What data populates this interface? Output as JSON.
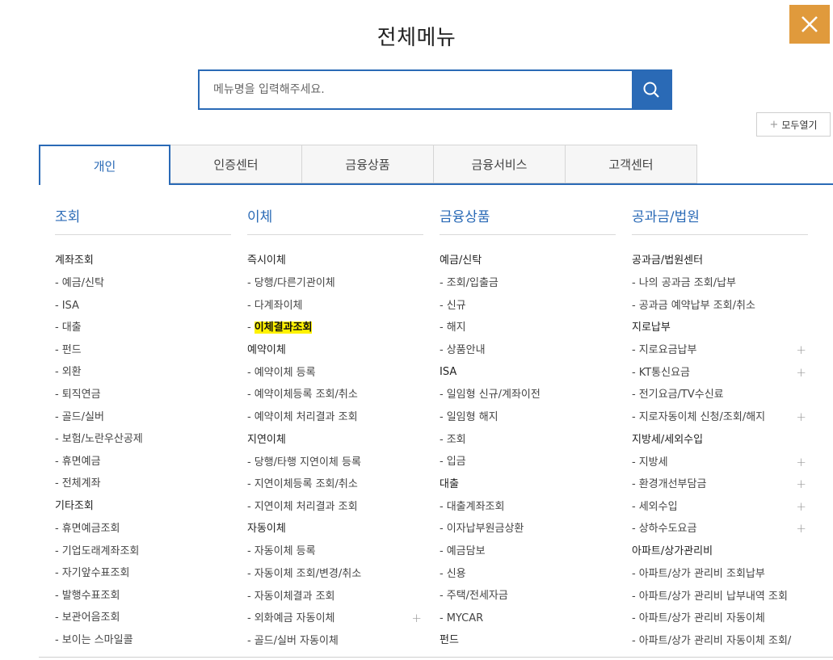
{
  "title": "전체메뉴",
  "close_icon": "close-icon",
  "search": {
    "placeholder": "메뉴명을 입력해주세요.",
    "value": ""
  },
  "open_all": {
    "plus": "+",
    "label": "모두열기"
  },
  "tabs": [
    {
      "label": "개인",
      "active": true
    },
    {
      "label": "인증센터"
    },
    {
      "label": "금융상품"
    },
    {
      "label": "금융서비스"
    },
    {
      "label": "고객센터"
    }
  ],
  "colors": {
    "accent": "#2a6ab6",
    "close_bg": "#e09a3c",
    "highlight": "#fff200"
  },
  "columns": [
    {
      "title": "조회",
      "groups": [
        {
          "title": "계좌조회",
          "items": [
            "예금/신탁",
            "ISA",
            "대출",
            "펀드",
            "외환",
            "퇴직연금",
            "골드/실버",
            "보험/노란우산공제",
            "휴면예금",
            "전체계좌"
          ]
        },
        {
          "title": "기타조회",
          "items": [
            "휴면예금조회",
            "기업도래계좌조회",
            "자기앞수표조회",
            "발행수표조회",
            "보관어음조회",
            "보이는 스마일콜"
          ]
        }
      ]
    },
    {
      "title": "이체",
      "groups": [
        {
          "title": "즉시이체",
          "items": [
            "당행/다른기관이체",
            "다계좌이체",
            "이체결과조회"
          ]
        },
        {
          "title": "예약이체",
          "items": [
            "예약이체 등록",
            "예약이체등록 조회/취소",
            "예약이체 처리결과 조회"
          ]
        },
        {
          "title": "지연이체",
          "items": [
            "당행/타행 지연이체 등록",
            "지연이체등록 조회/취소",
            "지연이체 처리결과 조회"
          ]
        },
        {
          "title": "자동이체",
          "items": [
            "자동이체 등록",
            "자동이체 조회/변경/취소",
            "자동이체결과 조회",
            "외화예금 자동이체",
            "골드/실버 자동이체"
          ]
        }
      ]
    },
    {
      "title": "금융상품",
      "groups": [
        {
          "title": "예금/신탁",
          "items": [
            "조회/입출금",
            "신규",
            "해지",
            "상품안내"
          ]
        },
        {
          "title": "ISA",
          "items": [
            "일임형 신규/계좌이전",
            "일임형 해지",
            "조회",
            "입금"
          ]
        },
        {
          "title": "대출",
          "items": [
            "대출계좌조회",
            "이자납부원금상환",
            "예금담보",
            "신용",
            "주택/전세자금",
            "MYCAR"
          ]
        },
        {
          "title": "펀드",
          "items": []
        }
      ]
    },
    {
      "title": "공과금/법원",
      "groups": [
        {
          "title": "공과금/법원센터",
          "items": [
            "나의 공과금 조회/납부",
            "공과금 예약납부 조회/취소"
          ]
        },
        {
          "title": "지로납부",
          "items": [
            "지로요금납부",
            "KT통신요금",
            "전기요금/TV수신료",
            "지로자동이체 신청/조회/해지"
          ]
        },
        {
          "title": "지방세/세외수입",
          "items": [
            "지방세",
            "환경개선부담금",
            "세외수입",
            "상하수도요금"
          ]
        },
        {
          "title": "아파트/상가관리비",
          "items": [
            "아파트/상가 관리비 조회납부",
            "아파트/상가 관리비 납부내역 조회",
            "아파트/상가 관리비 자동이체",
            "아파트/상가 관리비 자동이체 조회/"
          ]
        }
      ]
    }
  ],
  "dash": "-",
  "expand": "+"
}
